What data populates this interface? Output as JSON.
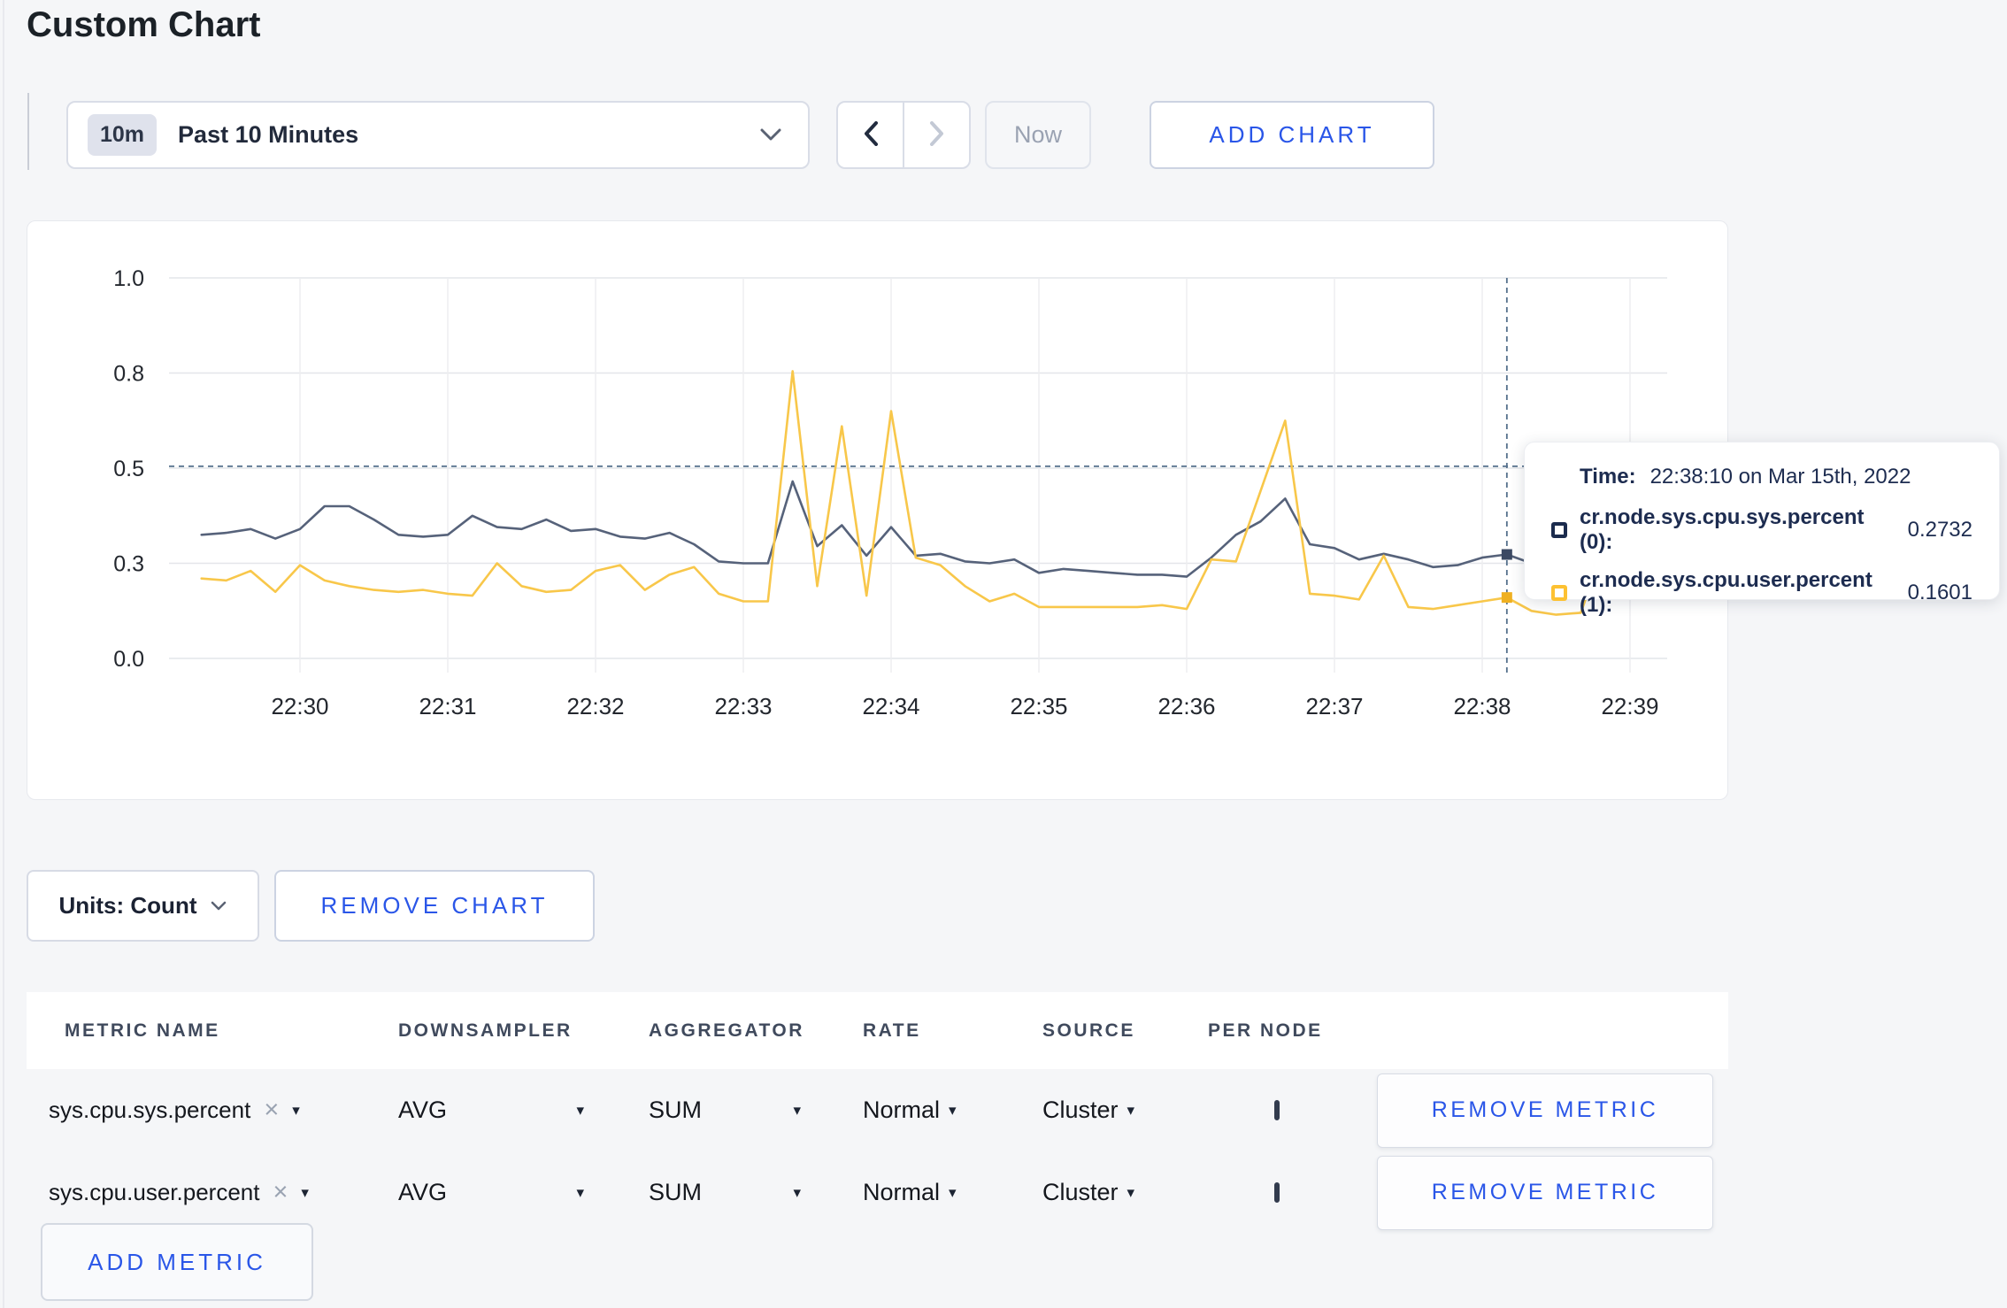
{
  "page": {
    "title": "Custom Chart"
  },
  "colors": {
    "accent_blue": "#2a56e8",
    "page_bg": "#f5f6f8",
    "card_bg": "#ffffff",
    "series_sys": "#56627a",
    "series_user": "#f8c74a",
    "crosshair": "#55708c"
  },
  "icons": {
    "dropdown": "▾",
    "remove": "×",
    "chevron_down": "chevron-down",
    "chevron_left": "chevron-left",
    "chevron_right": "chevron-right"
  },
  "toolbar": {
    "range_badge": "10m",
    "range_label": "Past 10 Minutes",
    "now_label": "Now",
    "add_chart_label": "ADD CHART"
  },
  "chart_data": {
    "type": "line",
    "title": "",
    "xlabel": "",
    "ylabel": "",
    "ylim": [
      0,
      1
    ],
    "grid": true,
    "x_start": "22:29:20",
    "x_interval_seconds": 10,
    "x_ticks": [
      "22:30",
      "22:31",
      "22:32",
      "22:33",
      "22:34",
      "22:35",
      "22:36",
      "22:37",
      "22:38",
      "22:39"
    ],
    "y_ticks": [
      {
        "label": "1.0",
        "frac": 1.0
      },
      {
        "label": "0.8",
        "frac": 0.75
      },
      {
        "label": "0.5",
        "frac": 0.5
      },
      {
        "label": "0.3",
        "frac": 0.25
      },
      {
        "label": "0.0",
        "frac": 0.0
      }
    ],
    "crosshair": {
      "index": 53,
      "time": "22:38:10",
      "y_value": 0.505
    },
    "series": [
      {
        "name": "cr.node.sys.cpu.sys.percent (0)",
        "color": "#56627a",
        "marker_color": "#3b4963",
        "values": [
          0.325,
          0.33,
          0.34,
          0.315,
          0.34,
          0.4,
          0.4,
          0.365,
          0.325,
          0.32,
          0.325,
          0.375,
          0.345,
          0.34,
          0.365,
          0.335,
          0.34,
          0.32,
          0.315,
          0.33,
          0.3,
          0.255,
          0.25,
          0.25,
          0.465,
          0.295,
          0.35,
          0.27,
          0.345,
          0.27,
          0.275,
          0.255,
          0.25,
          0.26,
          0.225,
          0.235,
          0.23,
          0.225,
          0.22,
          0.22,
          0.215,
          0.265,
          0.325,
          0.36,
          0.42,
          0.3,
          0.29,
          0.26,
          0.275,
          0.26,
          0.24,
          0.245,
          0.265,
          0.2732,
          0.25,
          0.3,
          0.31,
          0.3,
          0.32,
          0.3
        ]
      },
      {
        "name": "cr.node.sys.cpu.user.percent (1)",
        "color": "#f8c74a",
        "marker_color": "#efb021",
        "values": [
          0.21,
          0.205,
          0.23,
          0.175,
          0.245,
          0.205,
          0.19,
          0.18,
          0.175,
          0.18,
          0.17,
          0.165,
          0.25,
          0.19,
          0.175,
          0.18,
          0.23,
          0.245,
          0.18,
          0.22,
          0.24,
          0.17,
          0.15,
          0.15,
          0.755,
          0.19,
          0.61,
          0.165,
          0.65,
          0.265,
          0.245,
          0.19,
          0.15,
          0.17,
          0.135,
          0.135,
          0.135,
          0.135,
          0.135,
          0.14,
          0.13,
          0.26,
          0.255,
          0.44,
          0.625,
          0.17,
          0.165,
          0.155,
          0.27,
          0.135,
          0.13,
          0.14,
          0.15,
          0.1601,
          0.125,
          0.115,
          0.12,
          0.3,
          0.19,
          0.27
        ]
      }
    ]
  },
  "tooltip": {
    "time_label": "Time:",
    "time_value": "22:38:10 on Mar 15th, 2022",
    "rows": [
      {
        "label": "cr.node.sys.cpu.sys.percent (0):",
        "value": "0.2732",
        "swatch_color": "#1b2b4d"
      },
      {
        "label": "cr.node.sys.cpu.user.percent (1):",
        "value": "0.1601",
        "swatch_color": "#fdc132"
      }
    ]
  },
  "units_row": {
    "units_label": "Units: Count",
    "remove_chart_label": "REMOVE CHART"
  },
  "metrics_table": {
    "headers": [
      "METRIC NAME",
      "DOWNSAMPLER",
      "AGGREGATOR",
      "RATE",
      "SOURCE",
      "PER NODE"
    ],
    "rows": [
      {
        "name": "sys.cpu.sys.percent",
        "downsampler": "AVG",
        "aggregator": "SUM",
        "rate": "Normal",
        "source": "Cluster",
        "per_node_checked": false,
        "remove_label": "REMOVE METRIC"
      },
      {
        "name": "sys.cpu.user.percent",
        "downsampler": "AVG",
        "aggregator": "SUM",
        "rate": "Normal",
        "source": "Cluster",
        "per_node_checked": false,
        "remove_label": "REMOVE METRIC"
      }
    ],
    "add_metric_label": "ADD METRIC"
  }
}
